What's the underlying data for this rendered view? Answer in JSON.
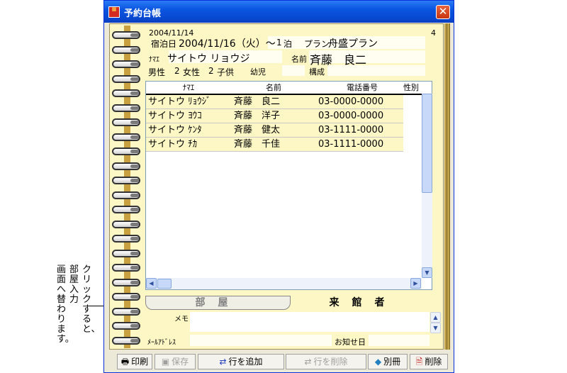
{
  "window": {
    "title": "予約台帳",
    "icon": "calendar-app-icon",
    "close_label": "✕"
  },
  "header": {
    "date": "2004/11/14",
    "page_no": "4",
    "stay_label": "宿泊日",
    "stay_date": "2004/11/16（火）～",
    "nights_value": "1",
    "nights_unit": "泊",
    "plan_label": "プラン",
    "plan_value": "舟盛プラン",
    "kana_label": "ﾅﾏｴ",
    "kana_value": "サイトウ リョウジ",
    "name_label": "名前",
    "name_value": "斉藤　良二",
    "male_label": "男性",
    "male_value": "2",
    "female_label": "女性",
    "female_value": "2",
    "child_label": "子供",
    "infant_label": "幼児",
    "composition_label": "構成"
  },
  "guests": {
    "columns": [
      "ﾅﾏｴ",
      "名前",
      "電話番号",
      "性別"
    ],
    "rows": [
      {
        "kana": "サイトウ ﾘｮｳｼﾞ",
        "name": "斉藤　良二",
        "phone": "03-0000-0000"
      },
      {
        "kana": "サイトウ ﾖｳｺ",
        "name": "斉藤　洋子",
        "phone": "03-0000-0000"
      },
      {
        "kana": "サイトウ ｹﾝﾀ",
        "name": "斉藤　健太",
        "phone": "03-1111-0000"
      },
      {
        "kana": "サイトウ ﾁｶ",
        "name": "斉藤　千佳",
        "phone": "03-1111-0000"
      }
    ]
  },
  "tabs": [
    {
      "label": "部屋",
      "active": false
    },
    {
      "label": "来館者",
      "active": true
    }
  ],
  "memo": {
    "memo_label": "メモ",
    "email_label": "ﾒｰﾙｱﾄﾞﾚｽ",
    "notify_label": "お知せ日"
  },
  "toolbar": {
    "print": "印刷",
    "save": "保存",
    "add_row": "行を追加",
    "delete_row": "行を削除",
    "other": "別冊",
    "delete": "削除"
  },
  "callout": {
    "lines": [
      "クリックすると、",
      "部屋入力",
      "画面へ替わります。"
    ]
  }
}
